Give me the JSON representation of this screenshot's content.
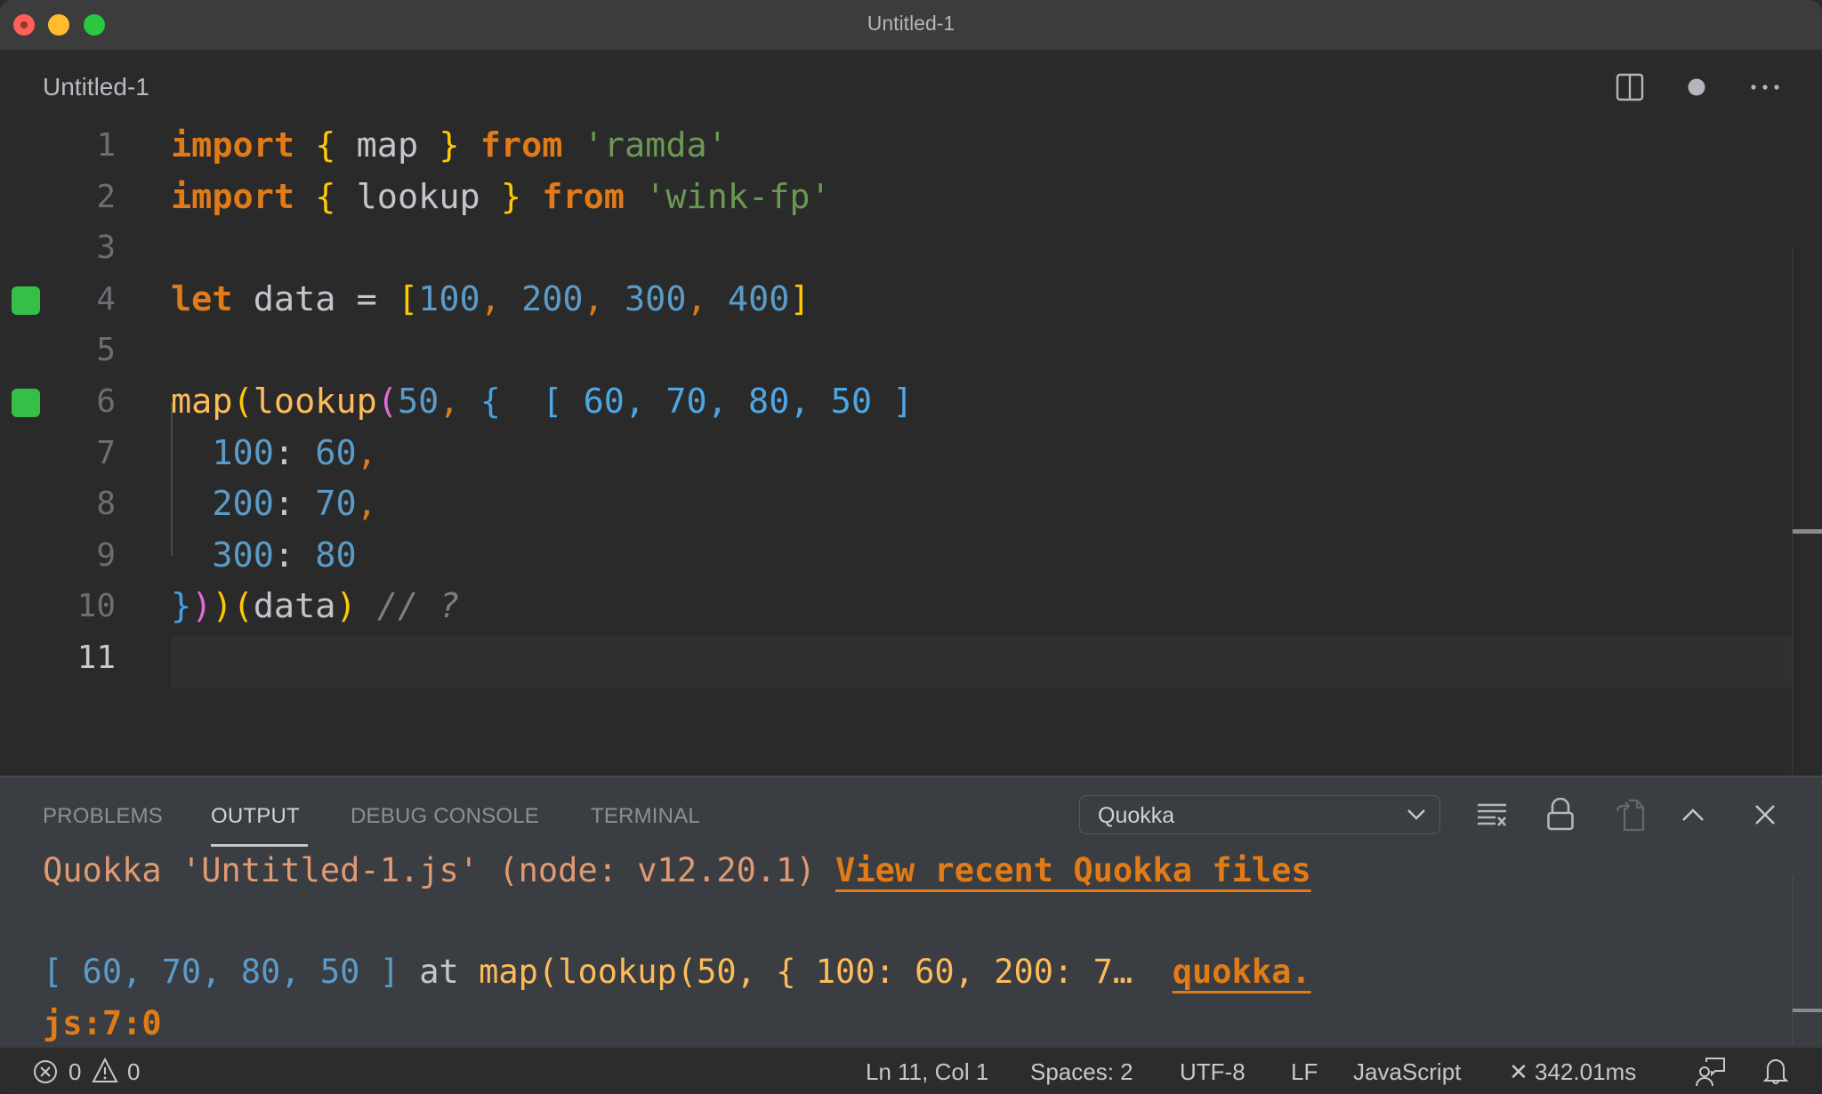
{
  "window": {
    "title": "Untitled-1"
  },
  "tab": {
    "label": "Untitled-1",
    "actions": [
      "split-editor-icon",
      "unsaved-dot-icon",
      "more-actions-icon"
    ]
  },
  "editor": {
    "lines": [
      {
        "n": "1",
        "tokens": [
          {
            "t": "import",
            "c": "kw"
          },
          {
            "t": " ",
            "c": "var"
          },
          {
            "t": "{",
            "c": "br-y"
          },
          {
            "t": " map ",
            "c": "var"
          },
          {
            "t": "}",
            "c": "br-y"
          },
          {
            "t": " ",
            "c": "var"
          },
          {
            "t": "from",
            "c": "kw"
          },
          {
            "t": " 'ramda'",
            "c": "str"
          }
        ]
      },
      {
        "n": "2",
        "tokens": [
          {
            "t": "import",
            "c": "kw"
          },
          {
            "t": " ",
            "c": "var"
          },
          {
            "t": "{",
            "c": "br-y"
          },
          {
            "t": " lookup ",
            "c": "var"
          },
          {
            "t": "}",
            "c": "br-y"
          },
          {
            "t": " ",
            "c": "var"
          },
          {
            "t": "from",
            "c": "kw"
          },
          {
            "t": " 'wink-fp'",
            "c": "str"
          }
        ]
      },
      {
        "n": "3",
        "tokens": []
      },
      {
        "n": "4",
        "marker": true,
        "tokens": [
          {
            "t": "let",
            "c": "kw"
          },
          {
            "t": " data = ",
            "c": "var"
          },
          {
            "t": "[",
            "c": "br-y"
          },
          {
            "t": "100",
            "c": "num"
          },
          {
            "t": ", ",
            "c": "punc"
          },
          {
            "t": "200",
            "c": "num"
          },
          {
            "t": ", ",
            "c": "punc"
          },
          {
            "t": "300",
            "c": "num"
          },
          {
            "t": ", ",
            "c": "punc"
          },
          {
            "t": "400",
            "c": "num"
          },
          {
            "t": "]",
            "c": "br-y"
          }
        ]
      },
      {
        "n": "5",
        "tokens": []
      },
      {
        "n": "6",
        "marker": true,
        "tokens": [
          {
            "t": "map",
            "c": "fn"
          },
          {
            "t": "(",
            "c": "br-y"
          },
          {
            "t": "lookup",
            "c": "fn"
          },
          {
            "t": "(",
            "c": "br-p"
          },
          {
            "t": "50",
            "c": "num"
          },
          {
            "t": ", ",
            "c": "punc"
          },
          {
            "t": "{",
            "c": "br-b"
          },
          {
            "t": "  [ 60, 70, 80, 50 ]",
            "c": "inline-result"
          }
        ]
      },
      {
        "n": "7",
        "tokens": [
          {
            "t": "  100",
            "c": "num"
          },
          {
            "t": ": ",
            "c": "var"
          },
          {
            "t": "60",
            "c": "num"
          },
          {
            "t": ",",
            "c": "punc"
          }
        ]
      },
      {
        "n": "8",
        "tokens": [
          {
            "t": "  200",
            "c": "num"
          },
          {
            "t": ": ",
            "c": "var"
          },
          {
            "t": "70",
            "c": "num"
          },
          {
            "t": ",",
            "c": "punc"
          }
        ]
      },
      {
        "n": "9",
        "tokens": [
          {
            "t": "  300",
            "c": "num"
          },
          {
            "t": ": ",
            "c": "var"
          },
          {
            "t": "80",
            "c": "num"
          }
        ]
      },
      {
        "n": "10",
        "tokens": [
          {
            "t": "}",
            "c": "br-b"
          },
          {
            "t": ")",
            "c": "br-p"
          },
          {
            "t": ")",
            "c": "br-y"
          },
          {
            "t": "(",
            "c": "br-y"
          },
          {
            "t": "data",
            "c": "var"
          },
          {
            "t": ")",
            "c": "br-y"
          },
          {
            "t": " // ?",
            "c": "cm"
          }
        ]
      },
      {
        "n": "11",
        "active": true,
        "tokens": []
      }
    ],
    "inline_result": "[ 60, 70, 80, 50 ]"
  },
  "panel": {
    "tabs": [
      {
        "label": "PROBLEMS",
        "active": false
      },
      {
        "label": "OUTPUT",
        "active": true
      },
      {
        "label": "DEBUG CONSOLE",
        "active": false
      },
      {
        "label": "TERMINAL",
        "active": false
      }
    ],
    "channel_select": {
      "value": "Quokka"
    },
    "tools": [
      "clear-output-icon",
      "lock-scroll-icon",
      "open-in-editor-icon",
      "maximize-panel-icon",
      "close-panel-icon"
    ],
    "output": {
      "header": "Quokka 'Untitled-1.js' (node: v12.20.1) ",
      "header_link": "View recent Quokka files",
      "result_value": "[ 60, 70, 80, 50 ]",
      "result_at": " at ",
      "result_expr": "map(lookup(50, { 100: 60, 200: 7…  ",
      "result_location_link": "quokka.",
      "result_location_cont": "js:7:0"
    }
  },
  "statusbar": {
    "errors": "0",
    "warnings": "0",
    "cursor": "Ln 11, Col 1",
    "indent": "Spaces: 2",
    "encoding": "UTF-8",
    "eol": "LF",
    "language": "JavaScript",
    "quokka_timing": "✕ 342.01ms"
  }
}
